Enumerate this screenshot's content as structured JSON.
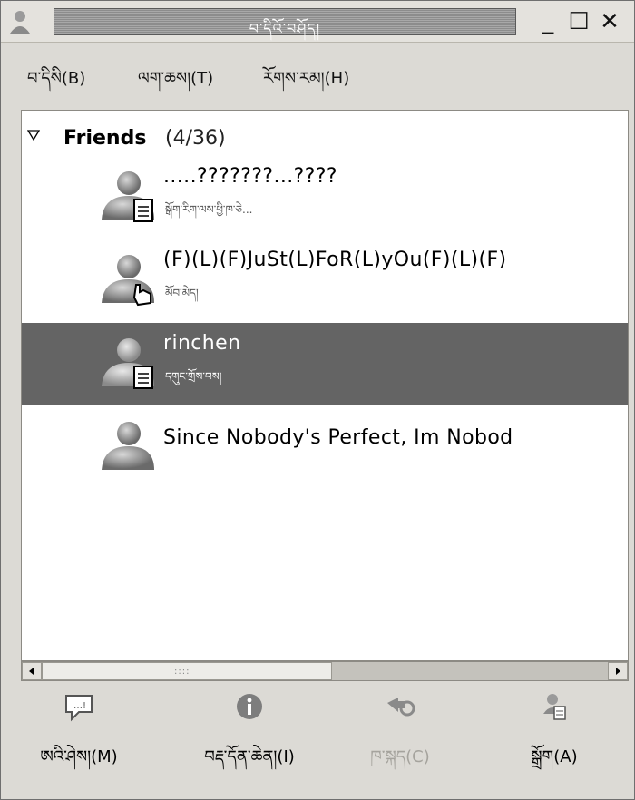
{
  "window": {
    "title": "བ་དིའོ་བཤོད།",
    "minimize_glyph": "_",
    "maximize_glyph": "☐",
    "close_glyph": "✕"
  },
  "menu": [
    {
      "label": "བ་དིསི(B)"
    },
    {
      "label": "ལག་ཆས།(T)"
    },
    {
      "label": "རོགས་རམ།(H)"
    }
  ],
  "group": {
    "name": "Friends",
    "count": "(4/36)"
  },
  "buddies": [
    {
      "name": ".....???????...????",
      "status": "སྒོག་རིག་ལས་ཕྱི་ཁ་ཅེ...",
      "emblem": "note",
      "selected": false
    },
    {
      "name": "(F)(L)(F)JuSt(L)FoR(L)yOu(F)(L)(F)",
      "status": "མོབ་མེད།",
      "emblem": "hand",
      "selected": false
    },
    {
      "name": "rinchen",
      "status": "དགུང་གྲོས་བས།",
      "emblem": "note",
      "selected": true
    },
    {
      "name": "Since Nobody's Perfect, Im Nobod",
      "status": "",
      "emblem": "none",
      "selected": false
    }
  ],
  "scrollbar": {
    "grip": "::::"
  },
  "toolbar": [
    {
      "label": "ཨའི་ཤེས།(M)",
      "icon": "message-icon",
      "enabled": true
    },
    {
      "label": "བརྡ་དོན་ཆེན།(I)",
      "icon": "info-icon",
      "enabled": true
    },
    {
      "label": "ཁ་སྐད(C)",
      "icon": "chat-icon",
      "enabled": false
    },
    {
      "label": "སྒྲོག(A)",
      "icon": "add-buddy-icon",
      "enabled": true
    }
  ],
  "colors": {
    "selected_row": "#646464",
    "title_fg": "#ffffff",
    "disabled_text": "#a5a39d"
  }
}
